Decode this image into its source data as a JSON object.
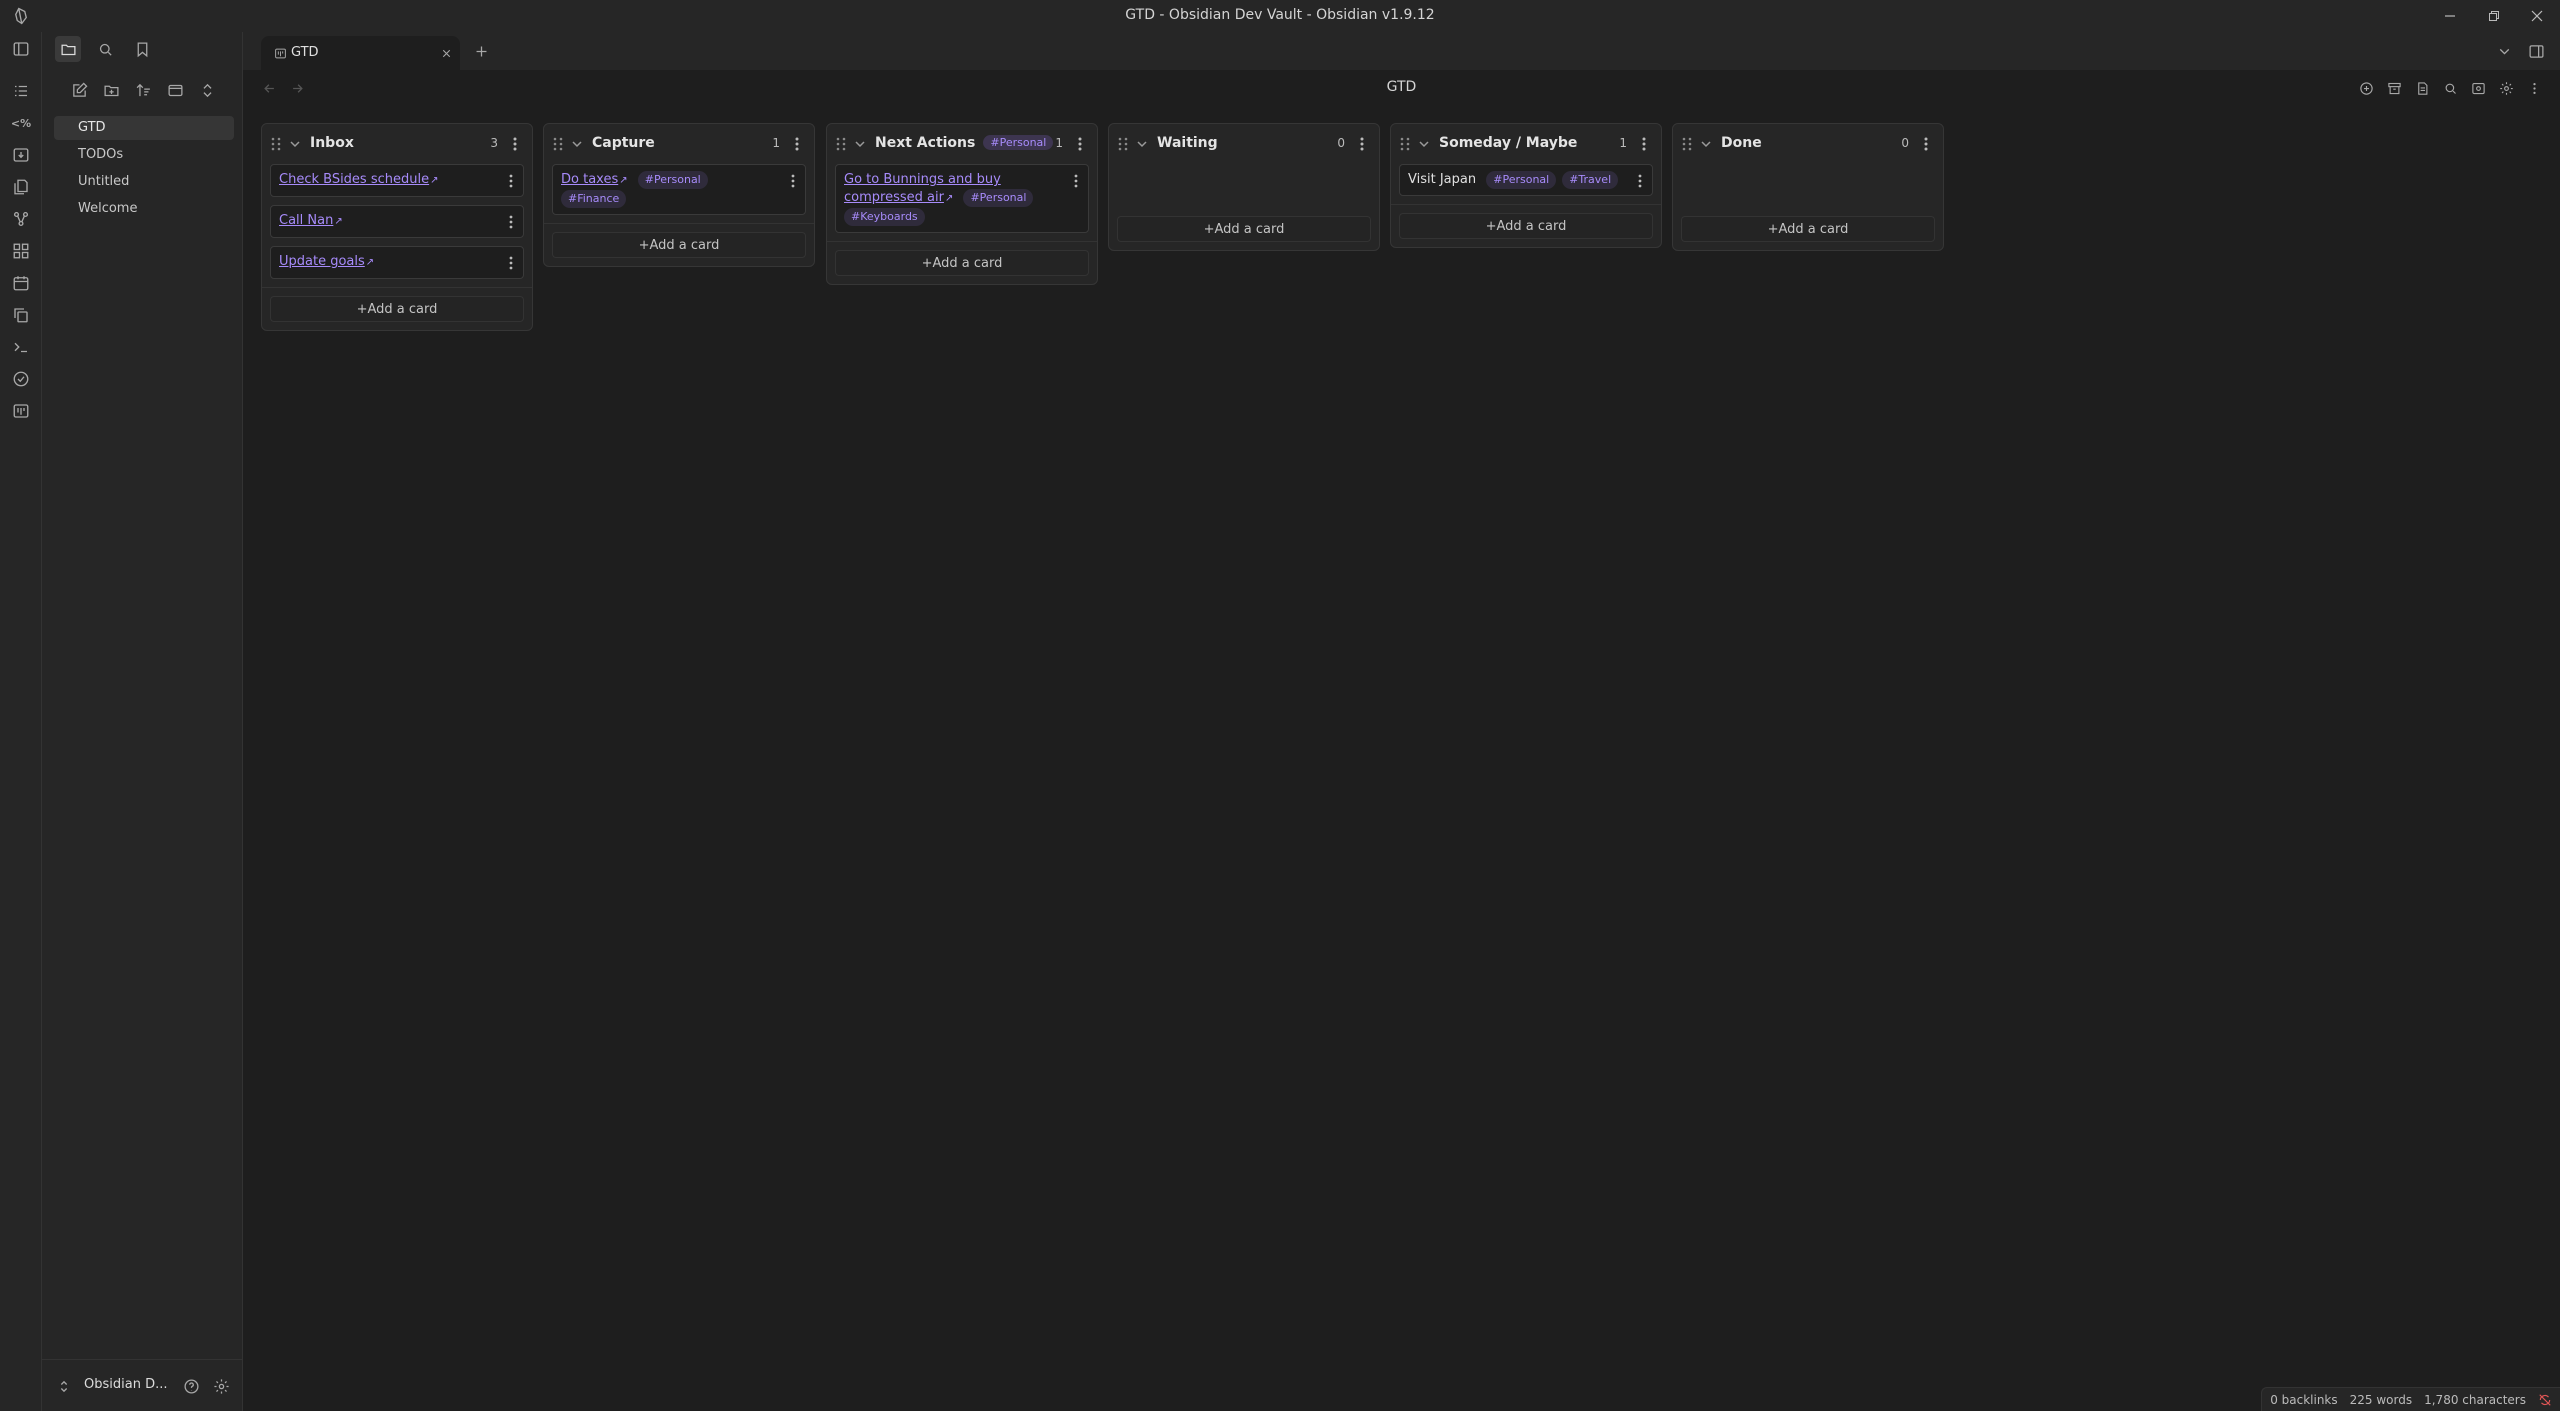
{
  "window": {
    "title": "GTD - Obsidian Dev Vault - Obsidian v1.9.12"
  },
  "sidebar": {
    "files": [
      {
        "label": "GTD",
        "active": true
      },
      {
        "label": "TODOs",
        "active": false
      },
      {
        "label": "Untitled",
        "active": false
      },
      {
        "label": "Welcome",
        "active": false
      }
    ],
    "vault_name": "Obsidian D..."
  },
  "tabs": [
    {
      "label": "GTD"
    }
  ],
  "view": {
    "title": "GTD"
  },
  "board": {
    "add_card_label": "+Add a card",
    "lanes": [
      {
        "title": "Inbox",
        "count": "3",
        "tag": "",
        "cards": [
          {
            "link": "Check BSides schedule",
            "tags": []
          },
          {
            "link": "Call Nan",
            "tags": []
          },
          {
            "link": "Update goals",
            "tags": []
          }
        ]
      },
      {
        "title": "Capture",
        "count": "1",
        "tag": "",
        "cards": [
          {
            "link": "Do taxes",
            "tags": [
              "#Personal",
              "#Finance"
            ]
          }
        ]
      },
      {
        "title": "Next Actions",
        "count": "1",
        "tag": "#Personal",
        "cards": [
          {
            "link": "Go to Bunnings and buy compressed air",
            "tags": [
              "#Personal",
              "#Keyboards"
            ]
          }
        ]
      },
      {
        "title": "Waiting",
        "count": "0",
        "tag": "",
        "cards": []
      },
      {
        "title": "Someday / Maybe",
        "count": "1",
        "tag": "",
        "cards": [
          {
            "text": "Visit Japan",
            "tags": [
              "#Personal",
              "#Travel"
            ]
          }
        ]
      },
      {
        "title": "Done",
        "count": "0",
        "tag": "",
        "cards": []
      }
    ]
  },
  "status": {
    "backlinks": "0 backlinks",
    "words": "225 words",
    "characters": "1,780 characters"
  },
  "colors": {
    "accent": "#a78bfa",
    "background": "#1e1e1e",
    "panel": "#262626"
  }
}
